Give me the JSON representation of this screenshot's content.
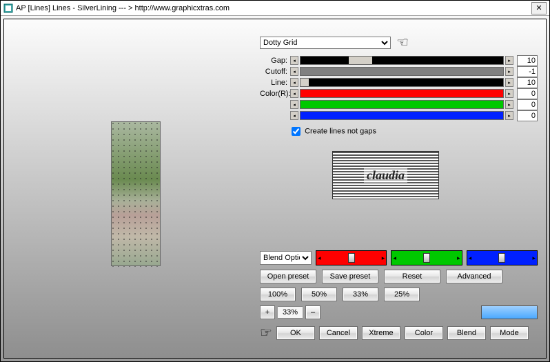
{
  "window": {
    "title": "AP [Lines]  Lines - SilverLining    --- >  http://www.graphicxtras.com"
  },
  "preset": {
    "selected": "Dotty Grid"
  },
  "sliders": {
    "gap": {
      "label": "Gap:",
      "value": "10"
    },
    "cutoff": {
      "label": "Cutoff:",
      "value": "-1"
    },
    "line": {
      "label": "Line:",
      "value": "10"
    },
    "colorR": {
      "label": "Color(R):",
      "value": "0"
    },
    "colorG": {
      "label": "",
      "value": "0"
    },
    "colorB": {
      "label": "",
      "value": "0"
    }
  },
  "checkbox": {
    "create_lines": "Create lines not gaps"
  },
  "logo": {
    "text": "claudia"
  },
  "blend": {
    "label": "Blend Options"
  },
  "presets_row": {
    "open": "Open preset",
    "save": "Save preset",
    "reset": "Reset",
    "advanced": "Advanced"
  },
  "zoom_presets": {
    "p100": "100%",
    "p50": "50%",
    "p33": "33%",
    "p25": "25%"
  },
  "zoom": {
    "plus": "+",
    "value": "33%",
    "minus": "–"
  },
  "actions": {
    "ok": "OK",
    "cancel": "Cancel",
    "xtreme": "Xtreme",
    "color": "Color",
    "blend": "Blend",
    "mode": "Mode"
  },
  "colors": {
    "red": "#ff0000",
    "green": "#00c800",
    "blue": "#0020ff",
    "black": "#000000",
    "gray": "#808080"
  }
}
